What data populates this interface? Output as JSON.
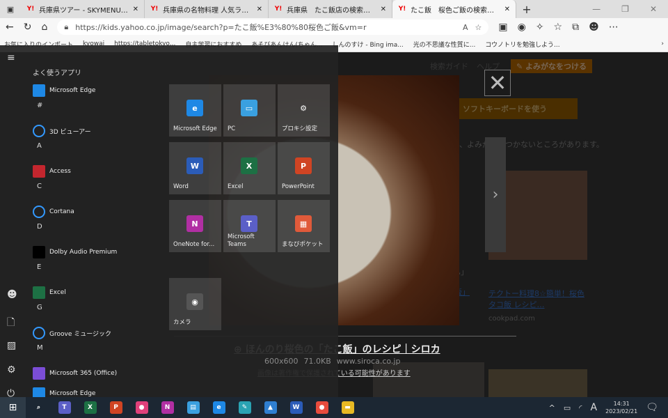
{
  "browser": {
    "tabs": [
      {
        "title": "兵庫県ツアー - SKYMENU発表ノート",
        "active": false
      },
      {
        "title": "兵庫県の名物料理 人気ランキング",
        "active": false
      },
      {
        "title": "兵庫県　たこ飯店の検索結果 - Yahoo",
        "active": false
      },
      {
        "title": "たこ飯　桜色ご飯の検索結果 - Yahoo",
        "active": true
      }
    ],
    "new_tab": "+",
    "url_host": "https://kids.yahoo.co.jp",
    "url_path": "/image/search?p=たこ飯%E3%80%80桜色ご飯&vm=r",
    "bookmarks": [
      "お気に入りのインポート",
      "kyowai",
      "https://tabletokyo...",
      "自主学習におすすめ",
      "あそびあんけん(ちゃん...",
      "しんのすけ - Bing ima...",
      "光の不思議な性質に...",
      "コウノトリを勉強しよう..."
    ]
  },
  "page": {
    "nav": [
      "検索ガイド",
      "ヘルプ"
    ],
    "yomigana_button": "よみがなをつける",
    "soft_keyboard_button": "ソフトキーボードを使う",
    "notice": "、よみがながつかないところがあります。",
    "result_caption": "テクトー料理8☆簡単！桜色タコ飯 レシピ…",
    "result_source": "cookpad.com",
    "partial_caption": "さん」",
    "partial_caption2": "こ飯」",
    "viewer": {
      "title": "ほんのり桜色の「たこ飯」のレシピ｜シロカ",
      "size": "600x600",
      "filesize": "71.0KB",
      "domain": "www.siroca.co.jp",
      "copyright": "画像は著作権で保護されている可能性があります"
    }
  },
  "start_menu": {
    "frequent_header": "よく使うアプリ",
    "apps": [
      {
        "type": "app",
        "label": "Microsoft Edge",
        "icon": "edge-icon",
        "color": "#1e88e5"
      },
      {
        "type": "group",
        "label": "#"
      },
      {
        "type": "app",
        "label": "3D ビューアー",
        "icon": "cube-icon",
        "color": "transparent"
      },
      {
        "type": "group",
        "label": "A"
      },
      {
        "type": "app",
        "label": "Access",
        "icon": "access-icon",
        "color": "#c4262e"
      },
      {
        "type": "group",
        "label": "C"
      },
      {
        "type": "app",
        "label": "Cortana",
        "icon": "cortana-icon",
        "color": "transparent"
      },
      {
        "type": "group",
        "label": "D"
      },
      {
        "type": "app",
        "label": "Dolby Audio Premium",
        "icon": "dolby-icon",
        "color": "#000000"
      },
      {
        "type": "group",
        "label": "E"
      },
      {
        "type": "app",
        "label": "Excel",
        "icon": "excel-icon",
        "color": "#1d7044"
      },
      {
        "type": "group",
        "label": "G"
      },
      {
        "type": "app",
        "label": "Groove ミュージック",
        "icon": "groove-icon",
        "color": "transparent"
      },
      {
        "type": "group",
        "label": "M"
      },
      {
        "type": "app",
        "label": "Microsoft 365 (Office)",
        "icon": "office-icon",
        "color": "#7b4dd6"
      },
      {
        "type": "app",
        "label": "Microsoft Edge",
        "icon": "edge-icon",
        "color": "#1e88e5"
      }
    ],
    "tiles": [
      {
        "label": "Microsoft Edge",
        "icon": "edge-icon",
        "color": "#1e88e5",
        "glyph": "e"
      },
      {
        "label": "PC",
        "icon": "pc-icon",
        "color": "#3aa0e0",
        "glyph": "▭"
      },
      {
        "label": "プロキシ設定",
        "icon": "gear-icon",
        "color": "transparent",
        "glyph": "⚙"
      },
      {
        "label": "Word",
        "icon": "word-icon",
        "color": "#2b5cb8",
        "glyph": "W"
      },
      {
        "label": "Excel",
        "icon": "excel-icon",
        "color": "#1d7044",
        "glyph": "X"
      },
      {
        "label": "PowerPoint",
        "icon": "powerpoint-icon",
        "color": "#d04423",
        "glyph": "P"
      },
      {
        "label": "OneNote for...",
        "icon": "onenote-icon",
        "color": "#b12fa3",
        "glyph": "N"
      },
      {
        "label": "Microsoft Teams",
        "icon": "teams-icon",
        "color": "#5b5fc7",
        "glyph": "T"
      },
      {
        "label": "まなびポケット",
        "icon": "manabi-pocket-icon",
        "color": "#e05a3a",
        "glyph": "▦"
      },
      {
        "label": "カメラ",
        "icon": "camera-icon",
        "color": "#555",
        "glyph": "◉"
      }
    ]
  },
  "taskbar": {
    "apps": [
      {
        "icon": "search-icon",
        "glyph": "⌕",
        "color": "transparent"
      },
      {
        "icon": "teams-icon",
        "glyph": "T",
        "color": "#5b5fc7"
      },
      {
        "icon": "excel-icon",
        "glyph": "X",
        "color": "#1d7044"
      },
      {
        "icon": "powerpoint-icon",
        "glyph": "P",
        "color": "#d04423"
      },
      {
        "icon": "paint-drop-icon",
        "glyph": "●",
        "color": "#e0407a"
      },
      {
        "icon": "onenote-icon",
        "glyph": "N",
        "color": "#b12fa3"
      },
      {
        "icon": "whiteboard-icon",
        "glyph": "▤",
        "color": "#3aa0e0"
      },
      {
        "icon": "edge-icon",
        "glyph": "e",
        "color": "#1e88e5"
      },
      {
        "icon": "skymenu-icon",
        "glyph": "✎",
        "color": "#2aa3b3"
      },
      {
        "icon": "photos-icon",
        "glyph": "▲",
        "color": "#2f7fd0"
      },
      {
        "icon": "word-icon",
        "glyph": "W",
        "color": "#2b5cb8"
      },
      {
        "icon": "maps-icon",
        "glyph": "●",
        "color": "#e84c3d"
      },
      {
        "icon": "file-explorer-icon",
        "glyph": "▬",
        "color": "#e8b923"
      }
    ],
    "ime": "A",
    "time": "14:31",
    "date": "2023/02/21"
  }
}
